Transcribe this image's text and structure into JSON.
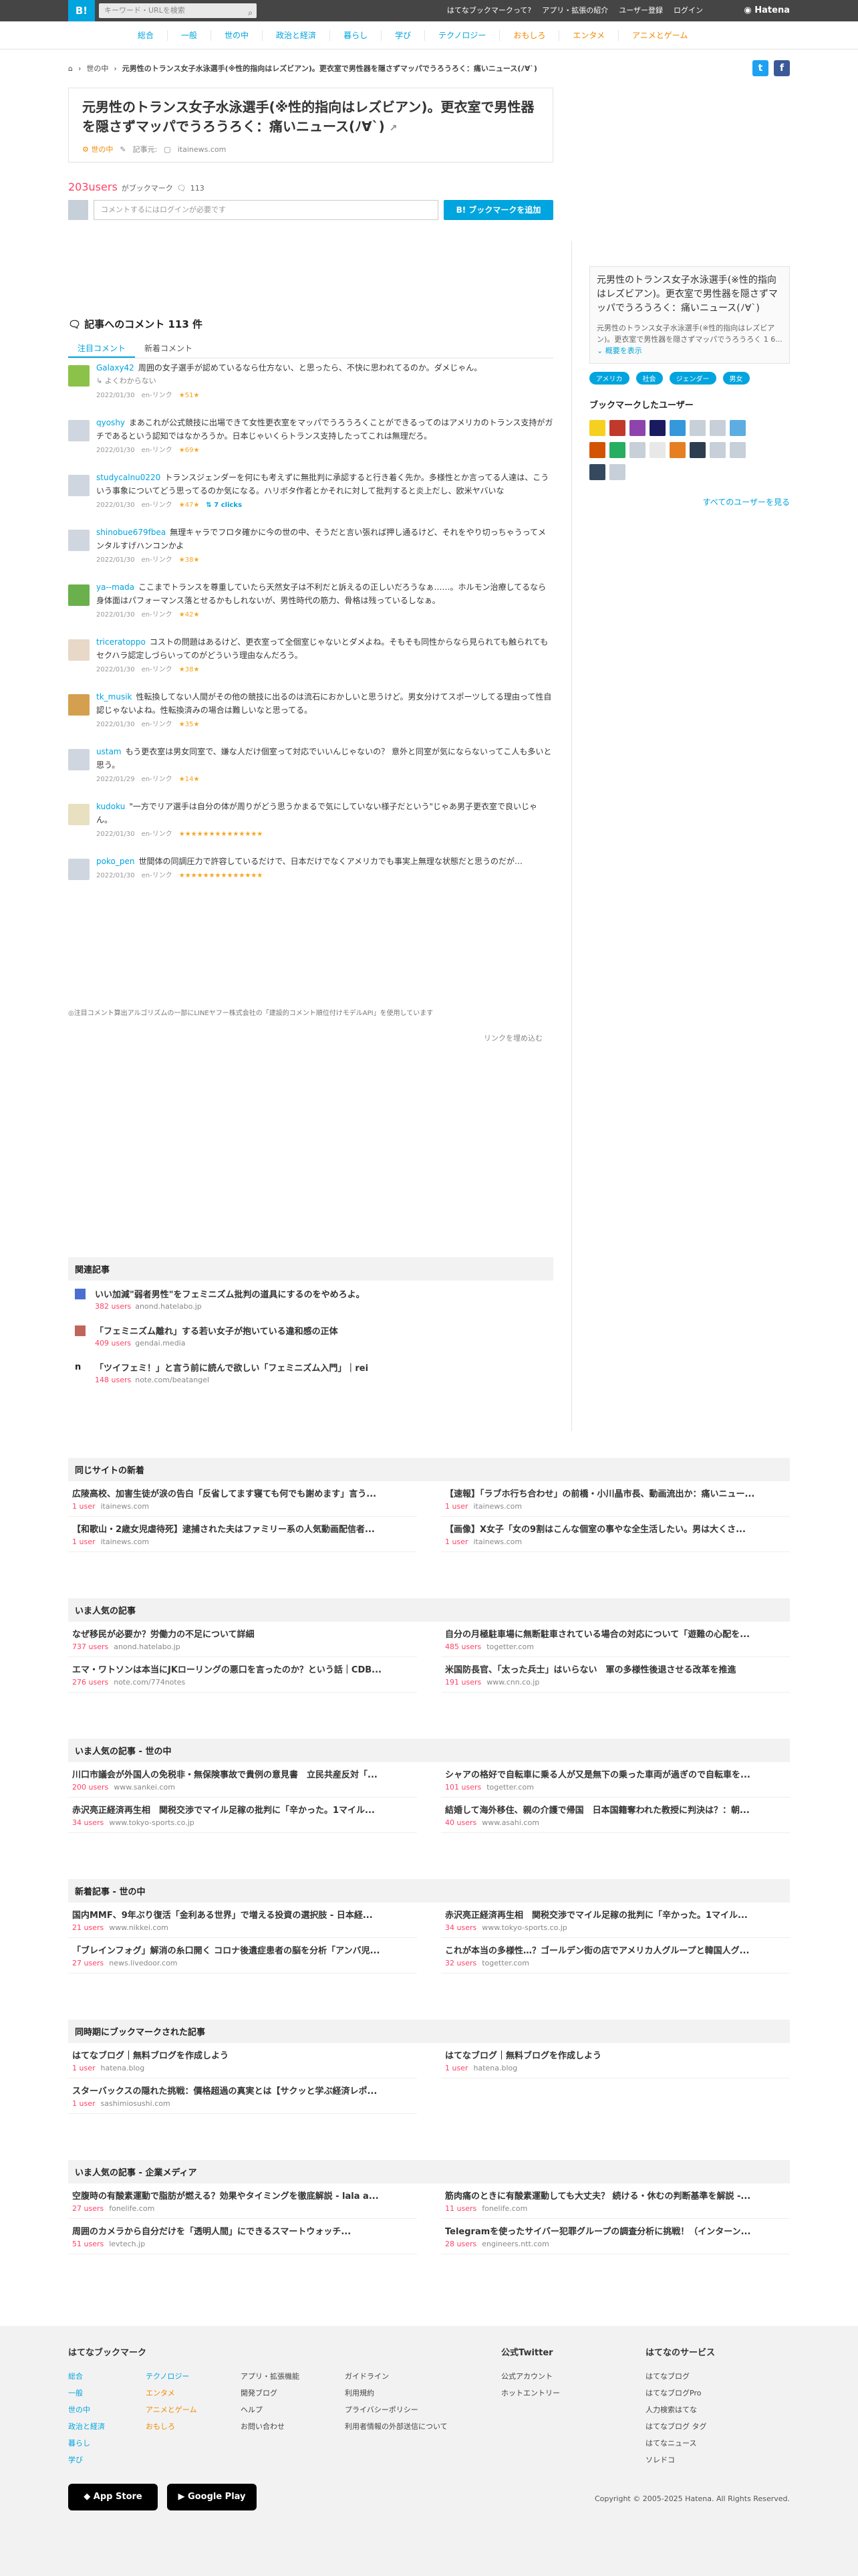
{
  "header": {
    "logo": "B!",
    "search_placeholder": "キーワード・URLを検索",
    "links": [
      "はてなブックマークって?",
      "アプリ・拡張の紹介",
      "ユーザー登録",
      "ログイン"
    ],
    "brand": "Hatena"
  },
  "nav": [
    "総合",
    "一般",
    "世の中",
    "政治と経済",
    "暮らし",
    "学び",
    "テクノロジー",
    "おもしろ",
    "エンタメ",
    "アニメとゲーム"
  ],
  "breadcrumb": {
    "category": "世の中",
    "title": "元男性のトランス女子水泳選手(※性的指向はレズビアン)。更衣室で男性器を隠さずマッパでうろうろく：痛いニュース(ﾉ∀`)"
  },
  "entry": {
    "title": "元男性のトランス女子水泳選手(※性的指向はレズビアン)。更衣室で男性器を隠さずマッパでうろうろく：痛いニュース(ﾉ∀`)",
    "category": "世の中",
    "date_label": "記事元:",
    "site": "itainews.com"
  },
  "bookmarks": {
    "users": "203users",
    "label": "がブックマーク",
    "comments_count": "113",
    "comment_placeholder": "コメントするにはログインが必要です",
    "add_button": "B! ブックマークを追加"
  },
  "comments_section": {
    "heading": "記事へのコメント 113 件",
    "tabs": [
      "注目コメント",
      "新着コメント"
    ]
  },
  "comments": [
    {
      "user": "Galaxy42",
      "text": "周囲の女子選手が認めているなら仕方ない、と思ったら、不快に思われてるのか。ダメじゃん。",
      "tag": "よくわからない",
      "date": "2022/01/30",
      "link": "en-リンク",
      "stars": "★51★"
    },
    {
      "user": "qyoshy",
      "text": "まあこれが公式競技に出場できて女性更衣室をマッパでうろうろくことができるってのはアメリカのトランス支持がガチであるという認知ではなかろうか。日本じゃいくらトランス支持したってこれは無理だろ。",
      "date": "2022/01/30",
      "link": "en-リンク",
      "stars": "★69★"
    },
    {
      "user": "studycalnu0220",
      "text": "トランスジェンダーを何にも考えずに無批判に承認すると行き着く先か。多様性とか言ってる人達は、こういう事象についてどう思ってるのか気になる。ハリボタ作者とかそれに対して批判すると炎上だし、欧米ヤバいな",
      "date": "2022/01/30",
      "link": "en-リンク",
      "stars": "★47★",
      "clicks": "7 clicks"
    },
    {
      "user": "shinobue679fbea",
      "text": "無理キャラでフロタ確かに今の世の中、そうだと言い張れば押し通るけど、それをやり切っちゃうってメンタルすげハンコンかよ",
      "date": "2022/01/30",
      "link": "en-リンク",
      "stars": "★38★"
    },
    {
      "user": "ya--mada",
      "text": "ここまでトランスを尊重していたら天然女子は不利だと訴えるの正しいだろうなぁ……。ホルモン治療してるなら身体面はパフォーマンス落とせるかもしれないが、男性時代の筋力、骨格は残っているしなぁ。",
      "date": "2022/01/30",
      "link": "en-リンク",
      "stars": "★42★"
    },
    {
      "user": "triceratoppo",
      "text": "コストの問題はあるけど、更衣室って全個室じゃないとダメよね。そもそも同性からなら見られても触られてもセクハラ認定しづらいってのがどういう理由なんだろう。",
      "date": "2022/01/30",
      "link": "en-リンク",
      "stars": "★38★"
    },
    {
      "user": "tk_musik",
      "text": "性転換してない人間がその他の競技に出るのは流石におかしいと思うけど。男女分けてスポーツしてる理由って性自認じゃないよね。性転換済みの場合は難しいなと思ってる。",
      "date": "2022/01/30",
      "link": "en-リンク",
      "stars": "★35★"
    },
    {
      "user": "ustam",
      "text": "もう更衣室は男女同室で、嫌な人だけ個室って対応でいいんじゃないの？ 意外と同室が気にならないってこ人も多いと思う。",
      "date": "2022/01/29",
      "link": "en-リンク",
      "stars": "★14★"
    },
    {
      "user": "kudoku",
      "text": "\"一方でリア選手は自分の体が周りがどう思うかまるで気にしていない様子だという\"じゃあ男子更衣室で良いじゃん。",
      "date": "2022/01/30",
      "link": "en-リンク",
      "stars": "★★★★★★★★★★★★★★"
    },
    {
      "user": "poko_pen",
      "text": "世間体の同調圧力で許容しているだけで、日本だけでなくアメリカでも事実上無理な状態だと思うのだが…",
      "date": "2022/01/30",
      "link": "en-リンク",
      "stars": "★★★★★★★★★★★★★★"
    }
  ],
  "notice": "◎注目コメント算出アルゴリズムの一部にLINEヤフー株式会社の「建設的コメント順位付けモデルAPI」を使用しています",
  "embed_link": "リンクを埋め込む",
  "related": {
    "heading": "関連記事",
    "items": [
      {
        "title": "いい加減\"弱者男性\"をフェミニズム批判の道具にするのをやめろよ。",
        "users": "382 users",
        "site": "anond.hatelabo.jp"
      },
      {
        "title": "「フェミニズム離れ」する若い女子が抱いている違和感の正体",
        "users": "409 users",
        "site": "gendai.media"
      },
      {
        "title": "「ツイフェミ！」と言う前に読んで欲しい「フェミニズム入門」｜rei",
        "users": "148 users",
        "site": "note.com/beatangel"
      }
    ]
  },
  "sidebar": {
    "title": "元男性のトランス女子水泳選手(※性的指向はレズビアン)。更衣室で男性器を隠さずマッパでうろうろく：痛いニュース(ﾉ∀`)",
    "desc": "元男性のトランス女子水泳選手(※性的指向はレズビアン)。更衣室で男性器を隠さずマッパでうろうろく 1 6...",
    "more": "概要を表示",
    "tags": [
      "アメリカ",
      "社会",
      "ジェンダー",
      "男女"
    ],
    "users_heading": "ブックマークしたユーザー",
    "all_users": "すべてのユーザーを見る"
  },
  "same_site": {
    "heading": "同じサイトの新着",
    "items": [
      {
        "title": "広陵高校、加害生徒が涙の告白「反省してます寝ても何でも謝めます」言う...",
        "users": "1 user",
        "site": "itainews.com"
      },
      {
        "title": "【速報】「ラブホ行ち合わせ」の前橋・小川晶市長、動画流出か：痛いニュー...",
        "users": "1 user",
        "site": "itainews.com"
      },
      {
        "title": "【和歌山・2歳女児虐待死】逮捕された夫はファミリー系の人気動画配信者...",
        "users": "1 user",
        "site": "itainews.com"
      },
      {
        "title": "【画像】X女子「女の9割はこんな個室の事やな全生活したい。男は大くさ...",
        "users": "1 user",
        "site": "itainews.com"
      }
    ]
  },
  "popular": {
    "heading": "いま人気の記事",
    "items": [
      {
        "title": "なぜ移民が必要か？労働力の不足について詳細",
        "users": "737 users",
        "site": "anond.hatelabo.jp"
      },
      {
        "title": "自分の月極駐車場に無断駐車されている場合の対応について「遊難の心配を...",
        "users": "485 users",
        "site": "togetter.com"
      },
      {
        "title": "エマ・ワトソンは本当にJKローリングの悪口を言ったのか？という話｜CDB...",
        "users": "276 users",
        "site": "note.com/774notes"
      },
      {
        "title": "米国防長官、「太った兵士」はいらない　軍の多様性後退させる改革を推進",
        "users": "191 users",
        "site": "www.cnn.co.jp"
      }
    ]
  },
  "popular_society": {
    "heading": "いま人気の記事 - 世の中",
    "items": [
      {
        "title": "川口市議会が外国人の免税非・無保険事故で貴例の意見書　立民共産反対「...",
        "users": "200 users",
        "site": "www.sankei.com"
      },
      {
        "title": "シャアの格好で自転車に乗る人が又是無下の乗った車両が過ぎので自転車を...",
        "users": "101 users",
        "site": "togetter.com"
      },
      {
        "title": "赤沢亮正経済再生相　関税交渉でマイル足稼の批判に「辛かった。1マイル...",
        "users": "34 users",
        "site": "www.tokyo-sports.co.jp"
      },
      {
        "title": "結婚して海外移住、親の介護で帰国　日本国籍奪われた教授に判決は？：朝...",
        "users": "40 users",
        "site": "www.asahi.com"
      }
    ]
  },
  "new_society": {
    "heading": "新着記事 - 世の中",
    "items": [
      {
        "title": "国内MMF、9年ぶり復活「金利ある世界」で増える投資の選択肢 - 日本経...",
        "users": "21 users",
        "site": "www.nikkei.com"
      },
      {
        "title": "赤沢亮正経済再生相　関税交渉でマイル足稼の批判に「辛かった。1マイル...",
        "users": "34 users",
        "site": "www.tokyo-sports.co.jp"
      },
      {
        "title": "「ブレインフォグ」解消の糸口開く コロナ後遺症患者の脳を分析「アンバ児...",
        "users": "27 users",
        "site": "news.livedoor.com"
      },
      {
        "title": "これが本当の多様性…？ゴールデン街の店でアメリカ人グループと韓国人グ...",
        "users": "32 users",
        "site": "togetter.com"
      }
    ]
  },
  "same_time": {
    "heading": "同時期にブックマークされた記事",
    "items": [
      {
        "title": "はてなブログ｜無料ブログを作成しよう",
        "users": "1 user",
        "site": "hatena.blog"
      },
      {
        "title": "はてなブログ｜無料ブログを作成しよう",
        "users": "1 user",
        "site": "hatena.blog"
      },
      {
        "title": "スターバックスの隠れた挑戦：價格超過の真実とは【サクッと学ぶ経済レポ...",
        "users": "1 user",
        "site": "sashimiosushi.com"
      }
    ]
  },
  "popular_corp": {
    "heading": "いま人気の記事 - 企業メディア",
    "items": [
      {
        "title": "空腹時の有酸素運動で脂肪が燃える？効果やタイミングを徹底解説 - lala a...",
        "users": "27 users",
        "site": "fonelife.com"
      },
      {
        "title": "筋肉痛のときに有酸素運動しても大丈夫？ 続ける・休むの判断基準を解説 -...",
        "users": "11 users",
        "site": "fonelife.com"
      },
      {
        "title": "周囲のカメラから自分だけを「透明人間」にできるスマートウォッチ...",
        "users": "51 users",
        "site": "levtech.jp"
      },
      {
        "title": "Telegramを使ったサイバー犯罪グループの調査分析に挑戦！（インターン...",
        "users": "28 users",
        "site": "engineers.ntt.com"
      }
    ]
  },
  "footer": {
    "col1_head": "はてなブックマーク",
    "col1a": [
      "総合",
      "一般",
      "世の中",
      "政治と経済",
      "暮らし",
      "学び"
    ],
    "col1b": [
      "テクノロジー",
      "エンタメ",
      "アニメとゲーム",
      "おもしろ"
    ],
    "col2": [
      "アプリ・拡張機能",
      "開発ブログ",
      "ヘルプ",
      "お問い合わせ"
    ],
    "col3": [
      "ガイドライン",
      "利用規約",
      "プライバシーポリシー",
      "利用者情報の外部送信について"
    ],
    "col4_head": "公式Twitter",
    "col4": [
      "公式アカウント",
      "ホットエントリー"
    ],
    "col5_head": "はてなのサービス",
    "col5": [
      "はてなブログ",
      "はてなブログPro",
      "人力検索はてな",
      "はてなブログ タグ",
      "はてなニュース",
      "ソレドコ"
    ],
    "appstore": "App Store",
    "googleplay": "Google Play",
    "copyright": "Copyright © 2005-2025 Hatena. All Rights Reserved."
  }
}
